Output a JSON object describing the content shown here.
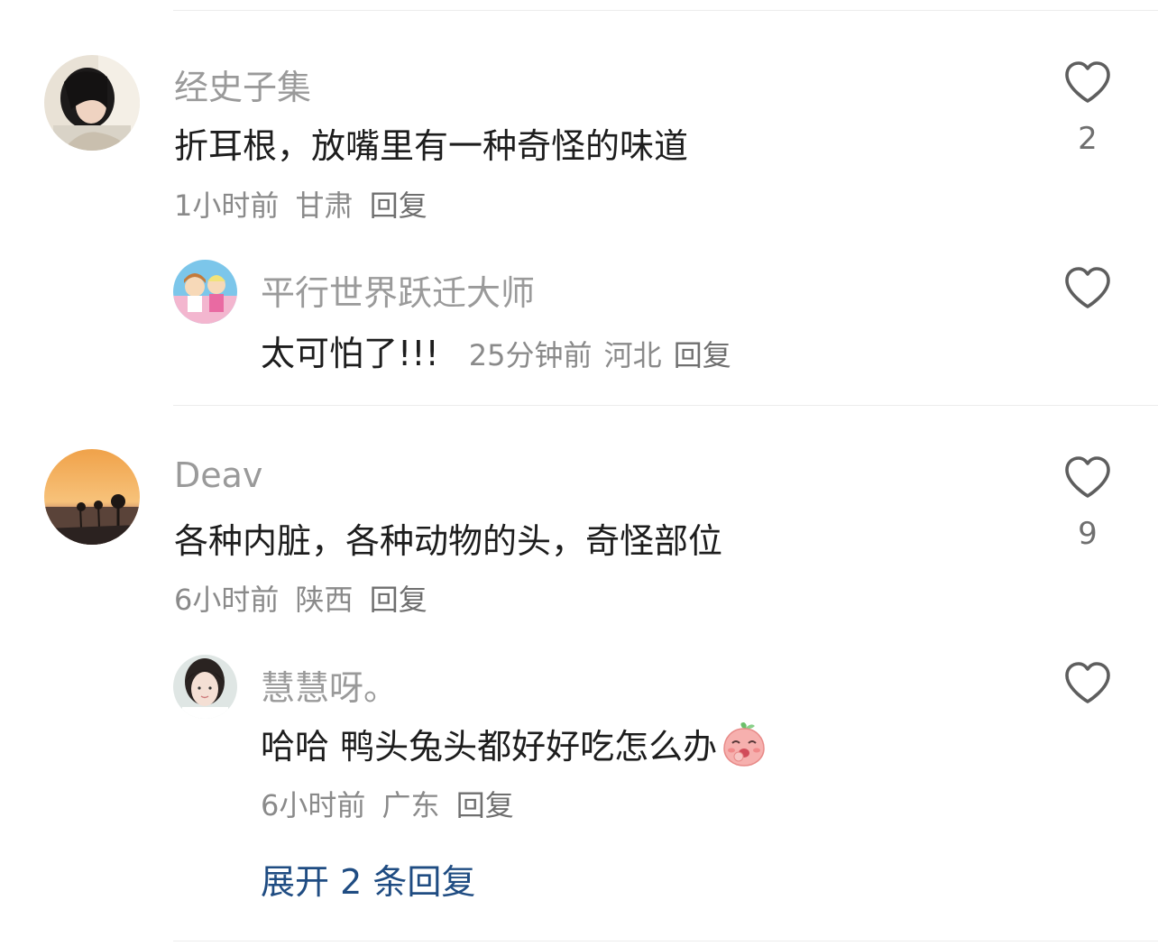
{
  "comments": [
    {
      "name": "经史子集",
      "text": "折耳根，放嘴里有一种奇怪的味道",
      "time": "1小时前",
      "location": "甘肃",
      "reply_label": "回复",
      "like_count": "2",
      "icon": "heart-outline-icon",
      "replies": [
        {
          "name": "平行世界跃迁大师",
          "text": "太可怕了!!!",
          "time": "25分钟前",
          "location": "河北",
          "reply_label": "回复",
          "icon": "heart-outline-icon"
        }
      ]
    },
    {
      "name": "Deav",
      "text": "各种内脏，各种动物的头，奇怪部位",
      "time": "6小时前",
      "location": "陕西",
      "reply_label": "回复",
      "like_count": "9",
      "icon": "heart-outline-icon",
      "replies": [
        {
          "name": "慧慧呀。",
          "text": "哈哈 鸭头兔头都好好吃怎么办",
          "emoji": "peach-laughing-emoji",
          "time": "6小时前",
          "location": "广东",
          "reply_label": "回复",
          "icon": "heart-outline-icon"
        }
      ],
      "expand_label": "展开 2 条回复"
    }
  ],
  "colors": {
    "name": "#9a9a9a",
    "meta": "#8a8a8a",
    "expand_link": "#1f4c82",
    "divider": "#ececec"
  }
}
